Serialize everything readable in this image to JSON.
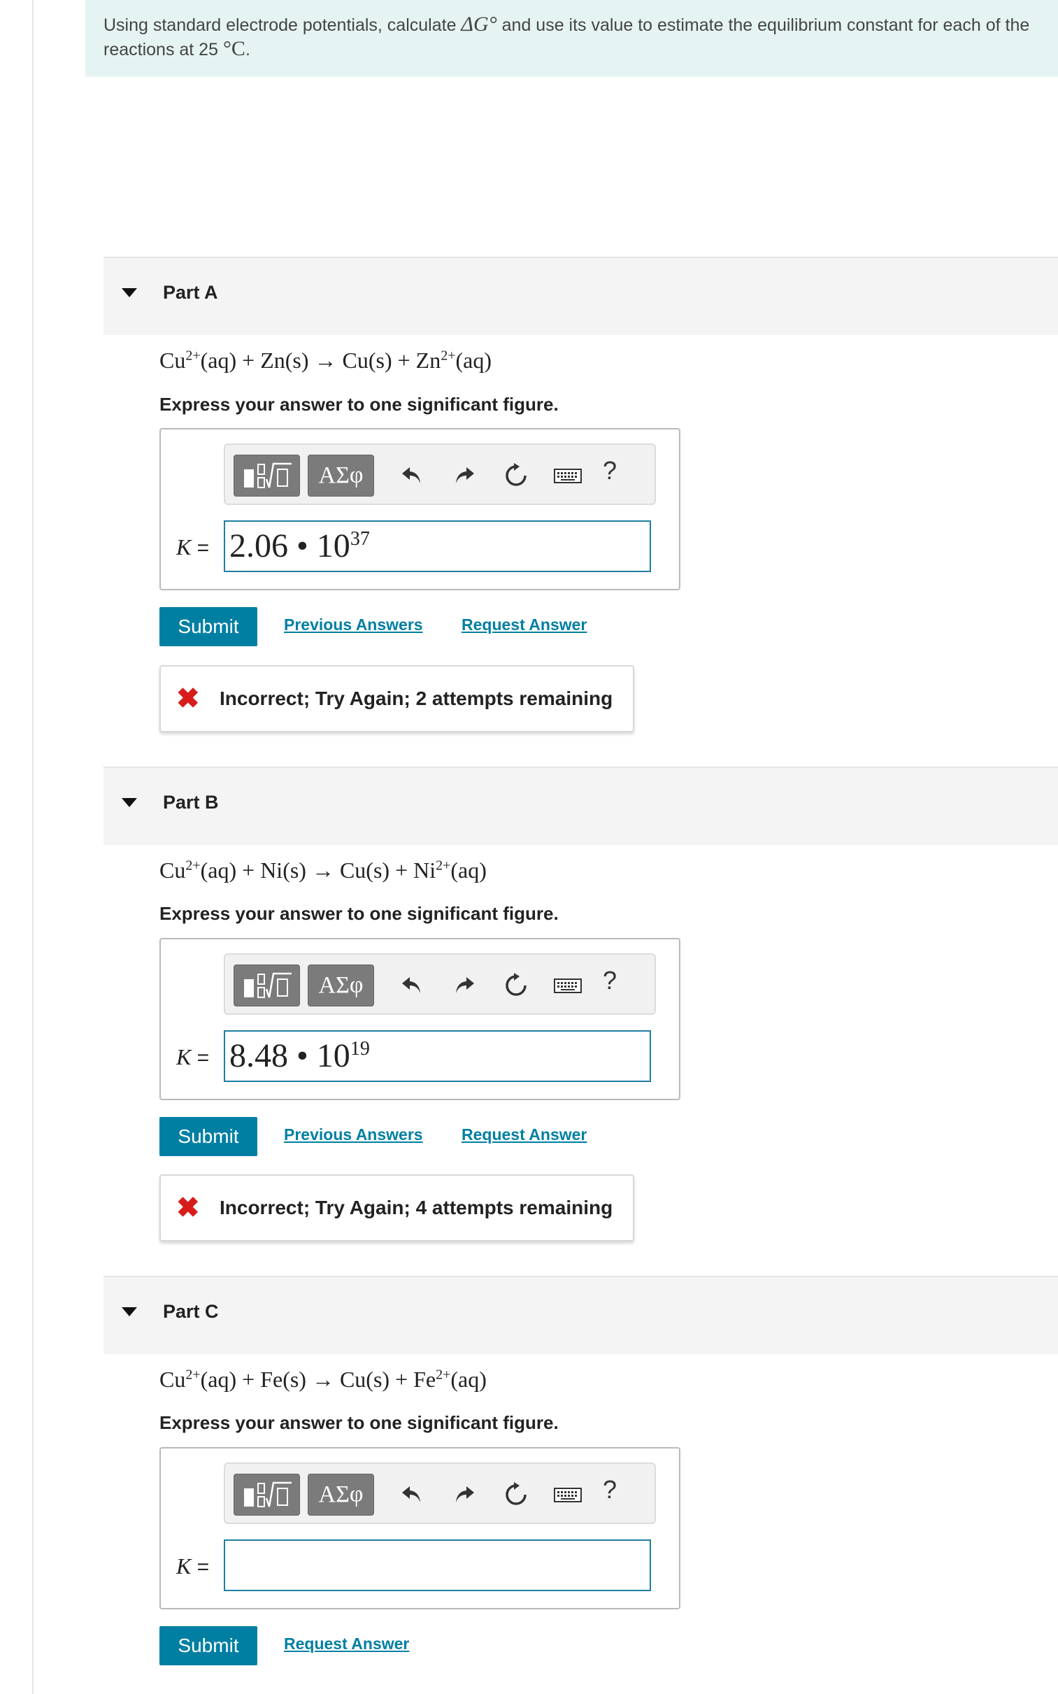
{
  "intro": {
    "text_before": "Using standard electrode potentials, calculate ",
    "math_delta_g": "ΔG°",
    "text_middle": " and use its value to estimate the equilibrium constant for each of the reactions at 25 ",
    "math_temp": "°C",
    "text_end": "."
  },
  "toolbar": {
    "greek_label": "ΑΣφ",
    "help_label": "?",
    "icons": [
      "template-icon",
      "undo-icon",
      "redo-icon",
      "reset-icon",
      "keyboard-icon"
    ]
  },
  "k_label": "K",
  "k_equals": " =",
  "hint": "Express your answer to one significant figure.",
  "submit_label": "Submit",
  "previous_answers_label": "Previous Answers",
  "request_answer_label": "Request Answer",
  "colors": {
    "accent": "#007fa3",
    "error": "#d81b1b",
    "intro_bg": "#e5f4f2"
  },
  "parts": [
    {
      "title": "Part A",
      "eq_left": "Cu",
      "eq_left_charge": "2+",
      "eq_mid": "(aq) + Zn(s) → Cu(s) + Zn",
      "eq_right_charge": "2+",
      "eq_end": "(aq)",
      "answer_mantissa": "2.06 • 10",
      "answer_exponent": "37",
      "feedback": "Incorrect; Try Again; 2 attempts remaining"
    },
    {
      "title": "Part B",
      "eq_left": "Cu",
      "eq_left_charge": "2+",
      "eq_mid": "(aq) + Ni(s) → Cu(s) + Ni",
      "eq_right_charge": "2+",
      "eq_end": "(aq)",
      "answer_mantissa": "8.48 • 10",
      "answer_exponent": "19",
      "feedback": "Incorrect; Try Again; 4 attempts remaining"
    },
    {
      "title": "Part C",
      "eq_left": "Cu",
      "eq_left_charge": "2+",
      "eq_mid": "(aq) + Fe(s) → Cu(s) + Fe",
      "eq_right_charge": "2+",
      "eq_end": "(aq)",
      "answer_mantissa": "",
      "answer_exponent": ""
    }
  ]
}
